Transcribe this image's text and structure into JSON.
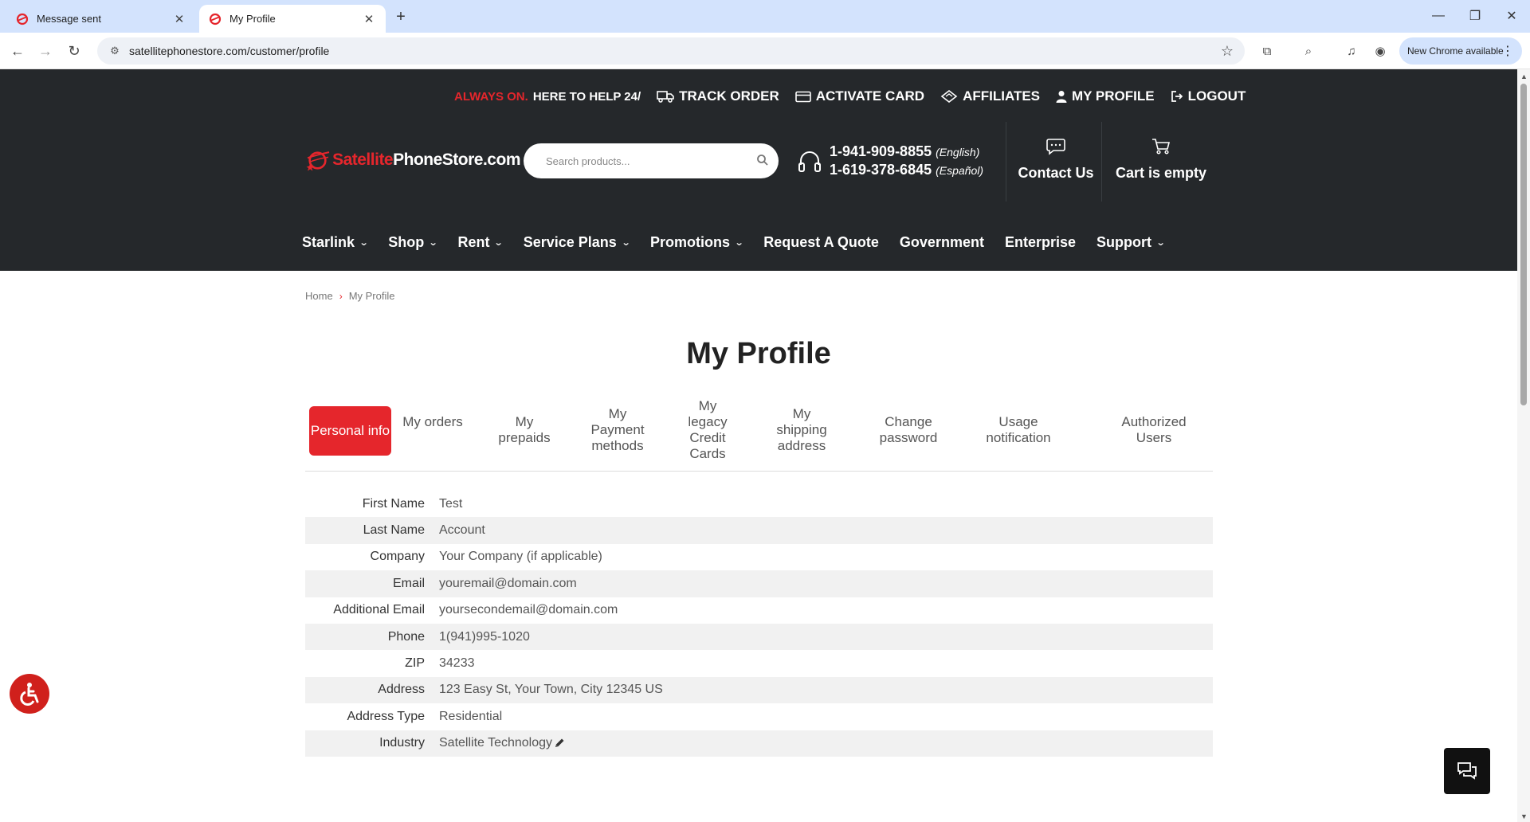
{
  "browser": {
    "tabs": [
      {
        "title": "Message sent",
        "active": false
      },
      {
        "title": "My Profile",
        "active": true
      }
    ],
    "new_tab_label": "+",
    "url": "satellitephonestore.com/customer/profile",
    "chrome_update_label": "New Chrome available"
  },
  "header": {
    "topbar": {
      "always_on": "ALWAYS ON.",
      "help": "HERE TO HELP 24/",
      "links": [
        "TRACK ORDER",
        "ACTIVATE CARD",
        "AFFILIATES",
        "MY PROFILE",
        "LOGOUT"
      ]
    },
    "logo": {
      "red": "Satellite",
      "white": "PhoneStore.com"
    },
    "search_placeholder": "Search products...",
    "phones": [
      {
        "number": "1-941-909-8855",
        "lang": "(English)"
      },
      {
        "number": "1-619-378-6845",
        "lang": "(Español)"
      }
    ],
    "contact_label": "Contact Us",
    "cart_label": "Cart is empty",
    "nav": [
      "Starlink",
      "Shop",
      "Rent",
      "Service Plans",
      "Promotions",
      "Request A Quote",
      "Government",
      "Enterprise",
      "Support"
    ]
  },
  "breadcrumb": {
    "home": "Home",
    "current": "My Profile"
  },
  "page_title": "My Profile",
  "profile_tabs": [
    "Personal info",
    "My orders",
    "My prepaids",
    "My Payment methods",
    "My legacy Credit Cards",
    "My shipping address",
    "Change password",
    "Usage notification",
    "Authorized Users"
  ],
  "personal_info": [
    {
      "label": "First Name",
      "value": "Test"
    },
    {
      "label": "Last Name",
      "value": "Account"
    },
    {
      "label": "Company",
      "value": "Your Company (if applicable)"
    },
    {
      "label": "Email",
      "value": "youremail@domain.com"
    },
    {
      "label": "Additional Email",
      "value": "yoursecondemail@domain.com"
    },
    {
      "label": "Phone",
      "value": "1(941)995-1020"
    },
    {
      "label": "ZIP",
      "value": "34233"
    },
    {
      "label": "Address",
      "value": "123 Easy St, Your Town, City 12345 US"
    },
    {
      "label": "Address Type",
      "value": "Residential"
    },
    {
      "label": "Industry",
      "value": "Satellite Technology"
    }
  ],
  "colors": {
    "brand_red": "#e5262c",
    "header_dark": "#25282b"
  }
}
